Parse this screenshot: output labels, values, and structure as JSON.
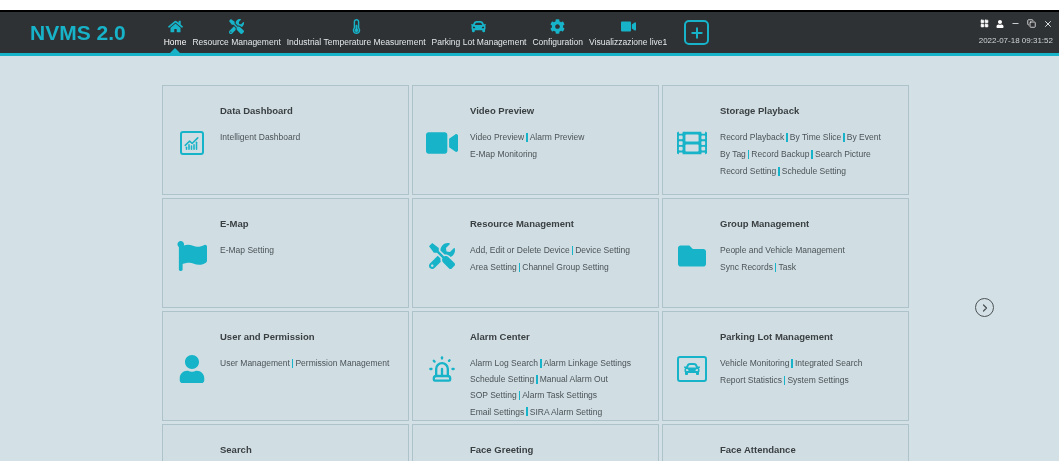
{
  "app": {
    "logo": "NVMS 2.0",
    "datetime": "2022-07-18 09:31:52"
  },
  "nav": [
    {
      "label": "Home",
      "selected": true
    },
    {
      "label": "Resource Management",
      "selected": false
    },
    {
      "label": "Industrial Temperature Measurement",
      "selected": false
    },
    {
      "label": "Parking Lot Management",
      "selected": false
    },
    {
      "label": "Configuration",
      "selected": false
    },
    {
      "label": "Visualizzazione live1",
      "selected": false
    }
  ],
  "cards": [
    {
      "title": "Data Dashboard",
      "lines": [
        [
          "Intelligent Dashboard"
        ]
      ]
    },
    {
      "title": "Video Preview",
      "lines": [
        [
          "Video Preview",
          "Alarm Preview"
        ],
        [
          "E-Map Monitoring"
        ]
      ]
    },
    {
      "title": "Storage Playback",
      "lines": [
        [
          "Record Playback",
          "By Time Slice",
          "By Event"
        ],
        [
          "By Tag",
          "Record Backup",
          "Search Picture"
        ],
        [
          "Record Setting",
          "Schedule Setting"
        ]
      ]
    },
    {
      "title": "E-Map",
      "lines": [
        [
          "E-Map Setting"
        ]
      ]
    },
    {
      "title": "Resource Management",
      "lines": [
        [
          "Add, Edit or Delete Device",
          "Device Setting"
        ],
        [
          "Area Setting",
          "Channel Group Setting"
        ]
      ]
    },
    {
      "title": "Group Management",
      "lines": [
        [
          "People and Vehicle Management"
        ],
        [
          "Sync Records",
          "Task"
        ]
      ]
    },
    {
      "title": "User and Permission",
      "lines": [
        [
          "User Management",
          "Permission Management"
        ]
      ]
    },
    {
      "title": "Alarm Center",
      "lines": [
        [
          "Alarm Log Search",
          "Alarm Linkage Settings"
        ],
        [
          "Schedule Setting",
          "Manual Alarm Out"
        ],
        [
          "SOP Setting",
          "Alarm Task Settings"
        ],
        [
          "Email Settings",
          "SIRA Alarm Setting"
        ]
      ]
    },
    {
      "title": "Parking Lot Management",
      "lines": [
        [
          "Vehicle Monitoring",
          "Integrated Search"
        ],
        [
          "Report Statistics",
          "System Settings"
        ]
      ]
    },
    {
      "title": "Search"
    },
    {
      "title": "Face Greeting"
    },
    {
      "title": "Face Attendance"
    }
  ]
}
